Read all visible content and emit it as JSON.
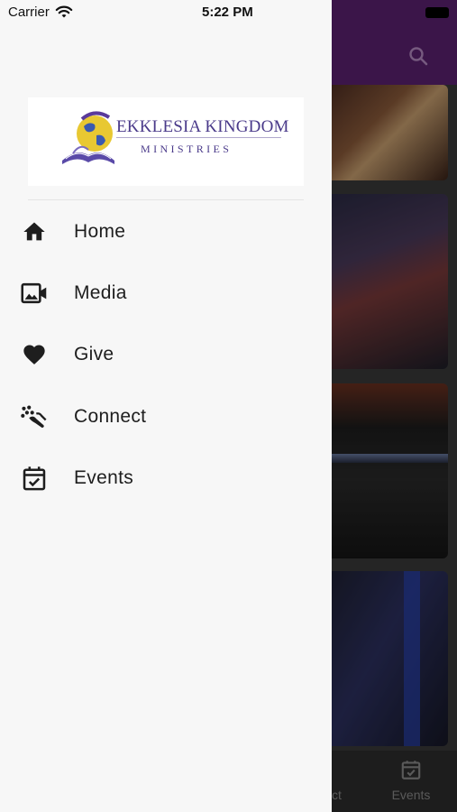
{
  "status_bar": {
    "carrier": "Carrier",
    "time": "5:22 PM"
  },
  "logo": {
    "title": "EKKLESIA KINGDOM",
    "subtitle": "MINISTRIES"
  },
  "menu": {
    "items": [
      {
        "label": "Home",
        "icon": "home-icon"
      },
      {
        "label": "Media",
        "icon": "video-library-icon"
      },
      {
        "label": "Give",
        "icon": "heart-icon"
      },
      {
        "label": "Connect",
        "icon": "connect-icon"
      },
      {
        "label": "Events",
        "icon": "calendar-check-icon"
      }
    ]
  },
  "background": {
    "header_color": "#5b2170",
    "tabbar": {
      "partial_label": "ct",
      "events_label": "Events"
    }
  }
}
